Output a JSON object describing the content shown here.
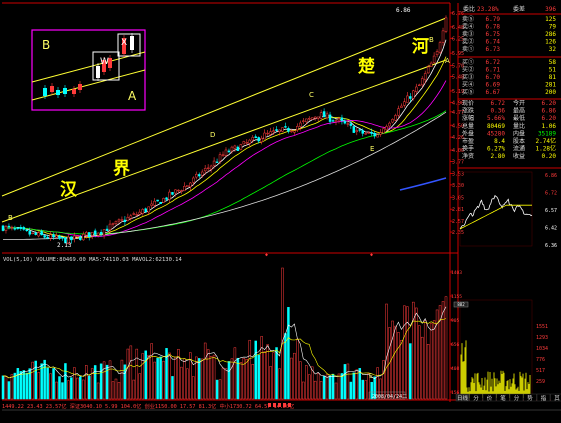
{
  "colors": {
    "up": "#ff3b3b",
    "down": "#00ffff",
    "ma5": "#ffffff",
    "ma10": "#ffff00",
    "ma20": "#ff00ff",
    "ma60": "#00ff00",
    "ma120": "#ffffff",
    "axis": "#cc0000",
    "text_red": "#ff3b3b",
    "text_yellow": "#ffff00",
    "text_green": "#00ff00",
    "text_white": "#ffffff"
  },
  "main": {
    "top_value": "6.86",
    "price_axis": [
      {
        "v": 6.76,
        "t": "6.76"
      },
      {
        "v": 6.48,
        "t": "6.48"
      },
      {
        "v": 6.25,
        "t": "6.25"
      },
      {
        "v": 5.95,
        "t": "5.95"
      },
      {
        "v": 5.7,
        "t": "5.70"
      },
      {
        "v": 5.48,
        "t": "5.48"
      },
      {
        "v": 5.19,
        "t": "5.19"
      },
      {
        "v": 4.96,
        "t": "4.96"
      },
      {
        "v": 4.77,
        "t": "4.77"
      },
      {
        "v": 4.5,
        "t": "4.50"
      },
      {
        "v": 4.26,
        "t": "4.26"
      },
      {
        "v": 4.0,
        "t": "4.00"
      },
      {
        "v": 3.77,
        "t": "3.77"
      },
      {
        "v": 3.53,
        "t": "3.53"
      },
      {
        "v": 3.3,
        "t": "3.30"
      },
      {
        "v": 3.05,
        "t": "3.05"
      },
      {
        "v": 2.81,
        "t": "2.81"
      },
      {
        "v": 2.57,
        "t": "2.57"
      },
      {
        "v": 2.35,
        "t": "2.35"
      }
    ],
    "labels": {
      "han": "汉",
      "jie": "界",
      "chu": "楚",
      "he": "河"
    },
    "points": {
      "B": "B",
      "D": "D",
      "C": "C",
      "E": "E",
      "A": "A",
      "low": "2.13"
    },
    "inset": {
      "B": "B",
      "A": "A",
      "W": "W",
      "X": "X"
    }
  },
  "volume": {
    "header": "VOL(5,10)  VOLUME:80469.00  MA5:74110.03  MAVOL2:62130.14",
    "axis": [
      "1403",
      "1155",
      "905",
      "656",
      "408",
      "156"
    ],
    "date": "2008/04/24二"
  },
  "quote": {
    "weibi_label": "委比",
    "weibi": "23.28%",
    "weicha_label": "委差",
    "weicha": "396",
    "sell": [
      {
        "l": "卖⑤",
        "p": "6.79",
        "v": "125"
      },
      {
        "l": "卖④",
        "p": "6.78",
        "v": "79"
      },
      {
        "l": "卖③",
        "p": "6.75",
        "v": "286"
      },
      {
        "l": "卖②",
        "p": "6.74",
        "v": "126"
      },
      {
        "l": "卖①",
        "p": "6.73",
        "v": "32"
      }
    ],
    "buy": [
      {
        "l": "买①",
        "p": "6.72",
        "v": "58"
      },
      {
        "l": "买②",
        "p": "6.71",
        "v": "51"
      },
      {
        "l": "买③",
        "p": "6.70",
        "v": "81"
      },
      {
        "l": "买④",
        "p": "6.69",
        "v": "281"
      },
      {
        "l": "买⑤",
        "p": "6.67",
        "v": "200"
      }
    ],
    "stats": [
      {
        "l1": "现价",
        "v1": "6.72",
        "l2": "今开",
        "v2": "6.20"
      },
      {
        "l1": "涨跌",
        "v1": "0.36",
        "l2": "最高",
        "v2": "6.86"
      },
      {
        "l1": "涨幅",
        "v1": "5.66%",
        "l2": "最低",
        "v2": "6.20"
      },
      {
        "l1": "总量",
        "v1": "80469",
        "l2": "量比",
        "v2": "1.06"
      },
      {
        "l1": "外盘",
        "v1": "45280",
        "l2": "内盘",
        "v2": "35189"
      },
      {
        "l1": "市盈",
        "v1": "8.4",
        "l2": "股本",
        "v2": "2.74亿"
      },
      {
        "l1": "换手",
        "v1": "6.27%",
        "l2": "流通",
        "v2": "1.28亿"
      },
      {
        "l1": "净资",
        "v1": "2.80",
        "l2": "收益",
        "v2": "0.20"
      }
    ]
  },
  "intraday": {
    "axis": [
      "6.86",
      "6.72",
      "6.57",
      "6.42",
      "6.36"
    ],
    "vol_axis": [
      "1551",
      "1293",
      "1034",
      "776",
      "517",
      "259"
    ],
    "vol_low": "259"
  },
  "tabs": [
    "日线",
    "分",
    "价",
    "笔",
    "分",
    "势",
    "指",
    "其"
  ],
  "status_bar": "1449.22 23.43 23.57亿  深证3040.10  5.99  104.0亿  创业1150.00  17.57  81.3亿  中小1730.72  64.57  14.20亿",
  "chart_data": {
    "type": "candlestick",
    "title": "",
    "y_range": [
      2.13,
      6.86
    ],
    "annotated_points": [
      {
        "label": "low",
        "value": 2.13
      },
      {
        "label": "high",
        "value": 6.86
      }
    ],
    "volume": {
      "VOLUME": 80469.0,
      "MA5": 74110.03,
      "MAVOL2": 62130.14
    }
  }
}
